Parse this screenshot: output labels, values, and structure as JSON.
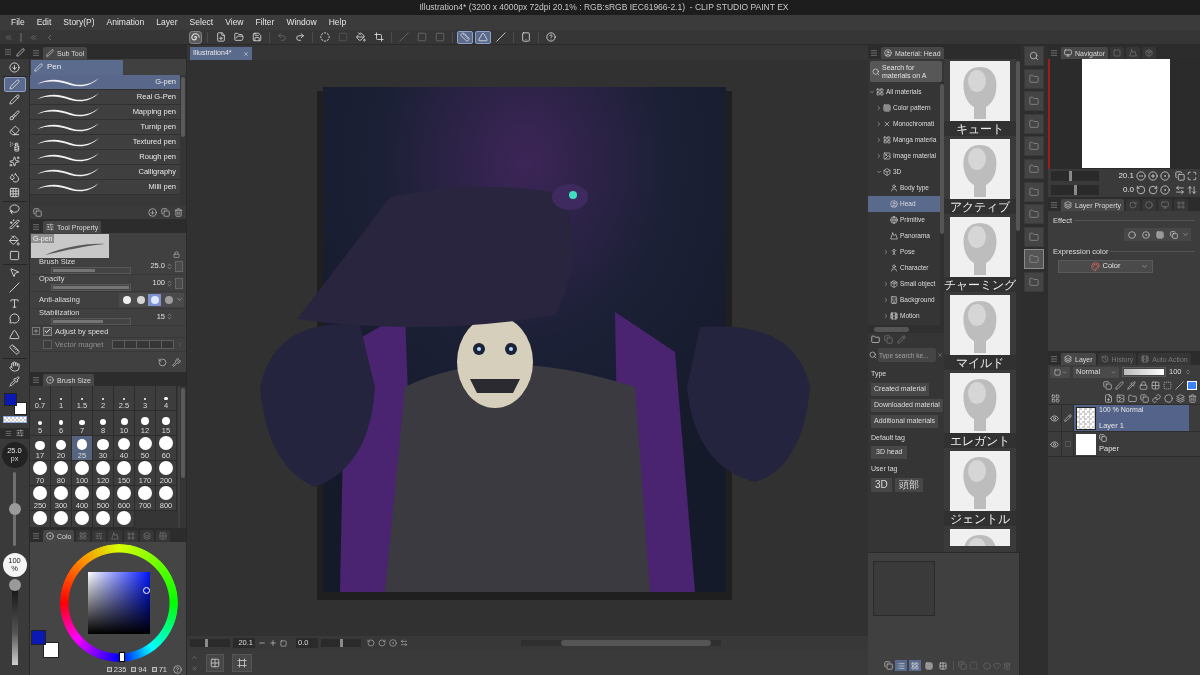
{
  "window": {
    "title": "Illustration4* (3200 x 4000px 72dpi 20.1% : RGB:sRGB IEC61966-2.1)  - CLIP STUDIO PAINT EX"
  },
  "menu": [
    "File",
    "Edit",
    "Story(P)",
    "Animation",
    "Layer",
    "Select",
    "View",
    "Filter",
    "Window",
    "Help"
  ],
  "command_bar": [
    {
      "disabled": false,
      "selected": false
    },
    {
      "disabled": false,
      "selected": false
    },
    {
      "disabled": false,
      "selected": false
    },
    {
      "disabled": true,
      "selected": false
    },
    {
      "disabled": false,
      "selected": false
    },
    {
      "disabled": false,
      "selected": false
    },
    {
      "disabled": true,
      "selected": false
    },
    {
      "disabled": false,
      "selected": false
    },
    {
      "disabled": false,
      "selected": false
    },
    {
      "disabled": true,
      "selected": false
    },
    {
      "disabled": true,
      "selected": false
    },
    {
      "disabled": true,
      "selected": false
    },
    {
      "disabled": false,
      "selected": true
    },
    {
      "disabled": false,
      "selected": true
    },
    {
      "disabled": false,
      "selected": false
    },
    {
      "disabled": false,
      "selected": false
    },
    {
      "disabled": false,
      "selected": false
    }
  ],
  "tools": [
    {
      "selected": false
    },
    {
      "selected": true
    },
    {
      "selected": false
    },
    {
      "selected": false
    },
    {
      "selected": false
    },
    {
      "selected": false
    },
    {
      "selected": false
    },
    {
      "selected": false
    },
    {
      "selected": false
    },
    {
      "selected": false
    },
    {
      "selected": false
    },
    {
      "selected": false
    },
    {
      "selected": false
    },
    {
      "selected": false
    },
    {
      "selected": false
    },
    {
      "selected": false
    },
    {
      "selected": false
    },
    {
      "selected": false
    },
    {
      "selected": false
    },
    {
      "selected": false
    },
    {
      "selected": false
    }
  ],
  "tool_colors": [
    {
      "color": "#0a18b4"
    },
    {
      "color": "#ffffff"
    }
  ],
  "tool_brush_size": {
    "value": "25.0",
    "unit": "px",
    "level": 0.5
  },
  "tool_opacity": {
    "value": "100",
    "unit": "%",
    "level": 1
  },
  "sub_tool": {
    "tabs": [
      {
        "label": "Sub Tool",
        "selected": true
      }
    ],
    "group": {
      "label": "Pen",
      "selected": true
    },
    "items": [
      {
        "label": "G-pen",
        "selected": true
      },
      {
        "label": "Real G-Pen",
        "selected": false
      },
      {
        "label": "Mapping pen",
        "selected": false
      },
      {
        "label": "Turnip pen",
        "selected": false
      },
      {
        "label": "Textured pen",
        "selected": false
      },
      {
        "label": "Rough pen",
        "selected": false
      },
      {
        "label": "Calligraphy",
        "selected": false
      },
      {
        "label": "Milli pen",
        "selected": false
      }
    ]
  },
  "tool_property": {
    "tabs": [
      {
        "label": "Tool Property",
        "selected": true
      }
    ],
    "preview_label": "G-pen",
    "rows": [
      {
        "kind": "slider",
        "label": "Brush Size",
        "value": "25.0",
        "level": 0.55
      },
      {
        "kind": "slider",
        "label": "Opacity",
        "value": "100",
        "level": 1
      },
      {
        "kind": "options",
        "label": "Anti-aliasing",
        "options": [
          {
            "selected": false
          },
          {
            "selected": false
          },
          {
            "selected": true
          },
          {
            "selected": false
          }
        ]
      },
      {
        "kind": "slider",
        "label": "Stabilization",
        "value": "15",
        "level": 0.66
      },
      {
        "kind": "checkbox",
        "label": "Adjust by speed",
        "checked": true,
        "expanded": false
      },
      {
        "kind": "magnet",
        "label": "Vector magnet",
        "checked": false,
        "disabled": true
      }
    ]
  },
  "brush_size_panel": {
    "tabs": [
      {
        "label": "Brush Size",
        "selected": true
      }
    ],
    "sizes": [
      {
        "label": "0.7",
        "selected": false
      },
      {
        "label": "1",
        "selected": false
      },
      {
        "label": "1.5",
        "selected": false
      },
      {
        "label": "2",
        "selected": false
      },
      {
        "label": "2.5",
        "selected": false
      },
      {
        "label": "3",
        "selected": false
      },
      {
        "label": "4",
        "selected": false
      },
      {
        "label": "5",
        "selected": false
      },
      {
        "label": "6",
        "selected": false
      },
      {
        "label": "7",
        "selected": false
      },
      {
        "label": "8",
        "selected": false
      },
      {
        "label": "10",
        "selected": false
      },
      {
        "label": "12",
        "selected": false
      },
      {
        "label": "15",
        "selected": false
      },
      {
        "label": "17",
        "selected": false
      },
      {
        "label": "20",
        "selected": false
      },
      {
        "label": "25",
        "selected": true
      },
      {
        "label": "30",
        "selected": false
      },
      {
        "label": "40",
        "selected": false
      },
      {
        "label": "50",
        "selected": false
      },
      {
        "label": "60",
        "selected": false
      },
      {
        "label": "70",
        "selected": false
      },
      {
        "label": "80",
        "selected": false
      },
      {
        "label": "100",
        "selected": false
      },
      {
        "label": "120",
        "selected": false
      },
      {
        "label": "150",
        "selected": false
      },
      {
        "label": "170",
        "selected": false
      },
      {
        "label": "200",
        "selected": false
      },
      {
        "label": "250",
        "selected": false
      },
      {
        "label": "300",
        "selected": false
      },
      {
        "label": "400",
        "selected": false
      },
      {
        "label": "500",
        "selected": false
      },
      {
        "label": "600",
        "selected": false
      },
      {
        "label": "700",
        "selected": false
      },
      {
        "label": "800",
        "selected": false
      },
      {
        "selected": false
      },
      {
        "selected": false
      },
      {
        "selected": false
      },
      {
        "selected": false
      },
      {
        "selected": false
      }
    ]
  },
  "color_panel": {
    "tabs": [
      {
        "label": "Colo",
        "selected": true
      },
      {
        "selected": false
      },
      {
        "selected": false
      },
      {
        "selected": false
      },
      {
        "selected": false
      },
      {
        "selected": false
      },
      {
        "selected": false
      }
    ],
    "colors": [
      {
        "color": "#0a18b4"
      },
      {
        "color": "#ffffff"
      }
    ],
    "readouts": [
      "235",
      "94",
      "71"
    ]
  },
  "canvas": {
    "tabs": [
      {
        "label": "Illustration4*",
        "selected": true
      }
    ],
    "zoom": {
      "value": "20.1",
      "level": 0.4
    },
    "rotation": {
      "value": "0.0",
      "level": 0.5
    }
  },
  "material_panel": {
    "tabs": [
      {
        "label": "Material: Head",
        "selected": true
      }
    ],
    "assets_search": "Search for materials on A",
    "tree": [
      {
        "label": "All materials",
        "expanded": true,
        "selected": false,
        "children": [
          {
            "label": "Color pattern",
            "expanded": false,
            "selected": false
          },
          {
            "label": "Monochromati",
            "expanded": false,
            "selected": false
          },
          {
            "label": "Manga materia",
            "expanded": false,
            "selected": false
          },
          {
            "label": "Image material",
            "expanded": false,
            "selected": false
          },
          {
            "label": "3D",
            "expanded": true,
            "selected": false,
            "children": [
              {
                "label": "Body type",
                "selected": false
              },
              {
                "label": "Head",
                "selected": true
              },
              {
                "label": "Primitive",
                "selected": false
              },
              {
                "label": "Panorama",
                "selected": false
              },
              {
                "label": "Pose",
                "expanded": false,
                "selected": false
              },
              {
                "label": "Character",
                "selected": false
              },
              {
                "label": "Small object",
                "expanded": false,
                "selected": false
              },
              {
                "label": "Background",
                "expanded": false,
                "selected": false
              },
              {
                "label": "Motion",
                "expanded": false,
                "selected": false
              }
            ]
          }
        ]
      }
    ],
    "keyword_placeholder": "Type search ke...",
    "type_label": "Type",
    "type_buttons": [
      "Created material",
      "Downloaded material",
      "Additional materials"
    ],
    "default_tag_label": "Default tag",
    "default_tags": [
      "3D head"
    ],
    "user_tag_label": "User tag",
    "user_tags": [
      "3D",
      "頭部"
    ],
    "thumbnails": [
      {
        "label": "キュート",
        "selected": false
      },
      {
        "label": "アクティブ",
        "selected": false
      },
      {
        "label": "チャーミング",
        "selected": false
      },
      {
        "label": "マイルド",
        "selected": false
      },
      {
        "label": "エレガント",
        "selected": false
      },
      {
        "label": "ジェントル",
        "selected": false
      },
      {
        "selected": false
      }
    ],
    "view_modes": [
      {
        "selected": true
      },
      {
        "selected": true
      },
      {
        "selected": false
      },
      {
        "selected": false
      }
    ]
  },
  "material_shortcuts": [
    {
      "selected": false
    },
    {
      "selected": false
    },
    {
      "selected": false
    },
    {
      "selected": false
    },
    {
      "selected": false
    },
    {
      "selected": false
    },
    {
      "selected": false
    },
    {
      "selected": false
    },
    {
      "selected": false
    },
    {
      "selected": true
    },
    {
      "selected": false
    }
  ],
  "navigator": {
    "tabs": [
      {
        "label": "Navigator",
        "selected": true
      },
      {
        "selected": false
      },
      {
        "selected": false
      },
      {
        "selected": false
      }
    ],
    "zoom": {
      "value": "20.1",
      "level": 0.4
    },
    "rotation": {
      "value": "0.0",
      "level": 0.5
    }
  },
  "layer_property": {
    "tabs": [
      {
        "label": "Layer Property",
        "selected": true
      },
      {
        "selected": false
      },
      {
        "selected": false
      },
      {
        "selected": false
      },
      {
        "selected": false
      }
    ],
    "effect_label": "Effect",
    "effects": [
      {
        "selected": false
      },
      {
        "selected": false
      },
      {
        "selected": false
      },
      {
        "selected": false
      }
    ],
    "expression_color_label": "Expression color",
    "expression_color": "Color"
  },
  "layer_panel": {
    "tabs": [
      {
        "label": "Layer",
        "selected": true
      },
      {
        "label": "History",
        "selected": false
      },
      {
        "label": "Auto Action",
        "selected": false
      }
    ],
    "blend_mode": "Normal",
    "opacity": {
      "value": "100",
      "level": 1
    },
    "layers": [
      {
        "kind": "raster",
        "mode": "100 % Normal",
        "name": "Layer 1",
        "selected": true,
        "visible": true,
        "editing": true
      },
      {
        "kind": "paper",
        "name": "Paper",
        "selected": false,
        "visible": true,
        "editing": false
      }
    ]
  }
}
